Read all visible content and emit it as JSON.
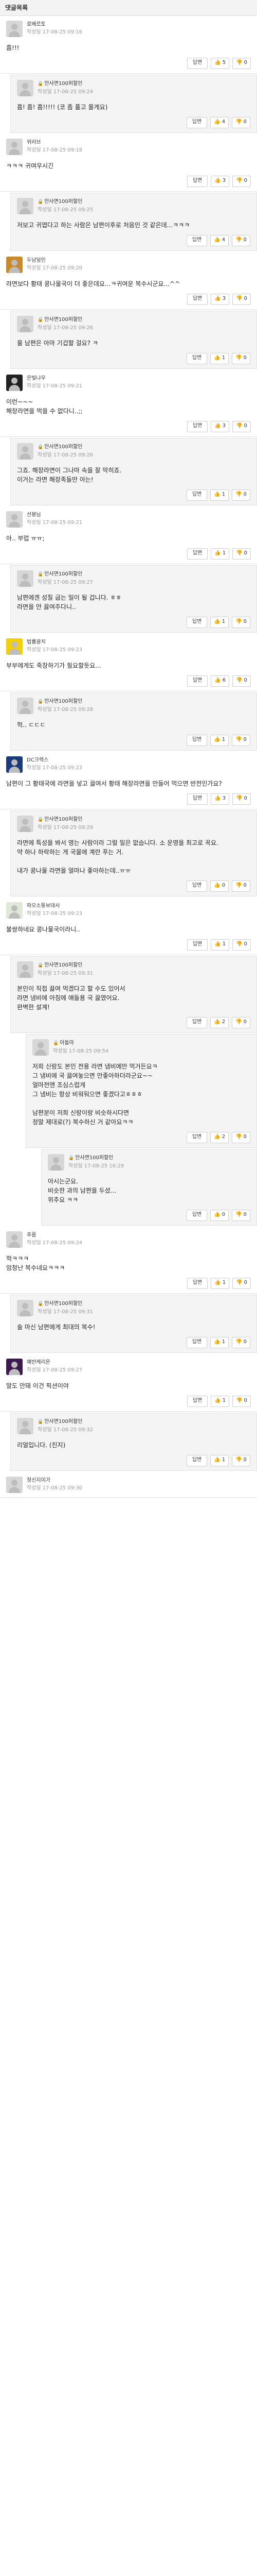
{
  "header": {
    "title": "댓글목록"
  },
  "labels": {
    "date_prefix": "작성일",
    "reply_button": "답변",
    "locked_glyph": "🔒"
  },
  "icons": {
    "up": "thumbs-up-icon",
    "down": "thumbs-down-icon"
  },
  "comments": [
    {
      "level": 0,
      "avatar": "default",
      "nick": "로베르토",
      "date": "17-08-25 09:16",
      "text": "흠!!!",
      "up": "5",
      "down": "0"
    },
    {
      "level": 1,
      "avatar": "default",
      "nick": "안사면100퍼할인",
      "date": "17-08-25 09:24",
      "text": "흠! 흠! 흠!!!!! (코 좀 풀고 올게요)",
      "up": "4",
      "down": "0",
      "locked": true
    },
    {
      "level": 0,
      "avatar": "default",
      "nick": "위러브",
      "date": "17-08-25 09:18",
      "text": "ㅋㅋㅋ 귀여우시긴",
      "up": "3",
      "down": "0"
    },
    {
      "level": 1,
      "avatar": "default",
      "nick": "안사면100퍼할인",
      "date": "17-08-25 09:25",
      "text": "저보고 귀엽다고 하는 사람은 남편이후로 처음인 것 같은데...ㅋㅋㅋ",
      "up": "4",
      "down": "0",
      "locked": true
    },
    {
      "level": 0,
      "avatar": "pic1",
      "nick": "두남일인",
      "date": "17-08-25 09:20",
      "text": "라면보다 황태 콩나물국이 더 좋은데요...ㅋ귀여운 복수시군요...^^",
      "up": "3",
      "down": "0"
    },
    {
      "level": 1,
      "avatar": "default",
      "nick": "안사면100퍼할인",
      "date": "17-08-25 09:26",
      "text": "울 남편은 아마 기겁할 걸요? ㅋ",
      "up": "1",
      "down": "0",
      "locked": true
    },
    {
      "level": 0,
      "avatar": "pic2",
      "nick": "은빛나무",
      "date": "17-08-25 09:21",
      "text": "이런~~~\n해장라면을 먹을 수 없다니..;;",
      "up": "3",
      "down": "0"
    },
    {
      "level": 1,
      "avatar": "default",
      "nick": "안사면100퍼할인",
      "date": "17-08-25 09:26",
      "text": "그죠. 해장라면이 그나마 속을 잘 막히죠.\n이거는 라면 해장족들만 아는!",
      "up": "1",
      "down": "0",
      "locked": true
    },
    {
      "level": 0,
      "avatar": "default",
      "nick": "선봉님",
      "date": "17-08-25 09:21",
      "text": "아.. 부럽 ㅠㅠ;",
      "up": "1",
      "down": "0"
    },
    {
      "level": 1,
      "avatar": "default",
      "nick": "안사면100퍼할인",
      "date": "17-08-25 09:27",
      "text": "남편에겐 성질 굽는 일이 될 겁니다. ㅎㅎ\n라면을 안 끓여주다니..",
      "up": "1",
      "down": "0",
      "locked": true
    },
    {
      "level": 0,
      "avatar": "pic3",
      "nick": "법률꿈치",
      "date": "17-08-25 09:23",
      "text": "부부에게도 죽창하기가 필요할듯요...",
      "up": "6",
      "down": "0"
    },
    {
      "level": 1,
      "avatar": "default",
      "nick": "안사면100퍼할인",
      "date": "17-08-25 09:28",
      "text": "헉.. ㄷㄷㄷ",
      "up": "1",
      "down": "0",
      "locked": true
    },
    {
      "level": 0,
      "avatar": "pic4",
      "nick": "DC크렉스",
      "date": "17-08-25 09:23",
      "text": "남편이 그 황태국에 라면을 넣고 끓여서 황태 해장라면을 만들어 먹으면 반전인가요?",
      "up": "3",
      "down": "0"
    },
    {
      "level": 1,
      "avatar": "default",
      "nick": "안사면100퍼할인",
      "date": "17-08-25 09:29",
      "text": "라면에 특성을 봐서 영는 사람이라 그럴 일은 없습니다. 소 운영을 최고로 꼭요.\n약 하나 하락하는 게 국물에 계란 푸는 거.\n\n내가 콩나물 라면을 얼마나 좋아하는데..ㅠㅠ",
      "up": "0",
      "down": "0",
      "locked": true
    },
    {
      "level": 0,
      "avatar": "pic5",
      "nick": "파오소통보대사",
      "date": "17-08-25 09:23",
      "text": "불쌍하네요 콩나물국이라니..",
      "up": "1",
      "down": "0"
    },
    {
      "level": 1,
      "avatar": "default",
      "nick": "안사면100퍼할인",
      "date": "17-08-25 09:31",
      "text": "본인이 직접 끓여 먹겠다고 할 수도 있어서\n라면 냄비에 아침에 애들용 국 끓였어요.\n완벽한 설계!",
      "up": "2",
      "down": "0",
      "locked": true
    },
    {
      "level": 2,
      "avatar": "default",
      "nick": "아돌마",
      "date": "17-08-25 09:54",
      "text": "저희 신랑도 본인 전용 라면 냄비에만 먹거든요ㅋ\n그 냄비에 국 끓여놓으면 안좋아하더라군요~~\n얼마전엔 조심스럽게\n그 냄비는 항상 비워둬으면 좋겠다고ㅎㅎㅎ\n\n남편분이 저희 신랑이랑 비슷하시다면\n정말 제대로(?) 복수하신 거 같아요ㅋㅋ",
      "up": "2",
      "down": "0",
      "locked": true
    },
    {
      "level": 3,
      "avatar": "default",
      "nick": "안사면100퍼할인",
      "date": "17-08-25 16:29",
      "text": "아시는군요.\n비슷한 과의 남편을 두셨...\n위추요 ㅋㅋ",
      "up": "0",
      "down": "0",
      "locked": true
    },
    {
      "level": 0,
      "avatar": "default",
      "nick": "푸름",
      "date": "17-08-25 09:24",
      "text": "헉ㅋㅋㅋ\n엄청난 복수네요ㅋㅋㅋ",
      "up": "1",
      "down": "0"
    },
    {
      "level": 1,
      "avatar": "default",
      "nick": "안사면100퍼할인",
      "date": "17-08-25 09:31",
      "text": "술 마신 남편에게 최대의 복수!",
      "up": "1",
      "down": "0",
      "locked": true
    },
    {
      "level": 0,
      "avatar": "pic6",
      "nick": "예반케리온",
      "date": "17-08-25 09:27",
      "text": "말도 안돼 이건 픽션이야",
      "up": "1",
      "down": "0"
    },
    {
      "level": 1,
      "avatar": "default",
      "nick": "안사면100퍼할인",
      "date": "17-08-25 09:32",
      "text": "리얼입니다. (진지)",
      "up": "1",
      "down": "0",
      "locked": true
    },
    {
      "level": 0,
      "avatar": "default",
      "nick": "청신지미가",
      "date": "17-08-25 09:30",
      "text": "",
      "up": "",
      "down": "",
      "partial": true
    }
  ]
}
